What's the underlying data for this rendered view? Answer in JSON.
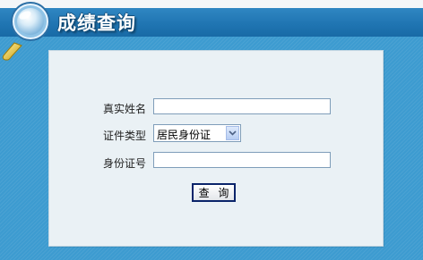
{
  "header": {
    "title": "成绩查询",
    "icon": "magnifier-icon"
  },
  "form": {
    "name_label": "真实姓名",
    "name_value": "",
    "id_type_label": "证件类型",
    "id_type_selected": "居民身份证",
    "id_number_label": "身份证号",
    "id_number_value": "",
    "submit_label": "查 询"
  },
  "colors": {
    "background": "#3d9bd0",
    "header_bar": "#1f74b1",
    "panel": "#eaf1f5",
    "button_border": "#0a246a"
  }
}
